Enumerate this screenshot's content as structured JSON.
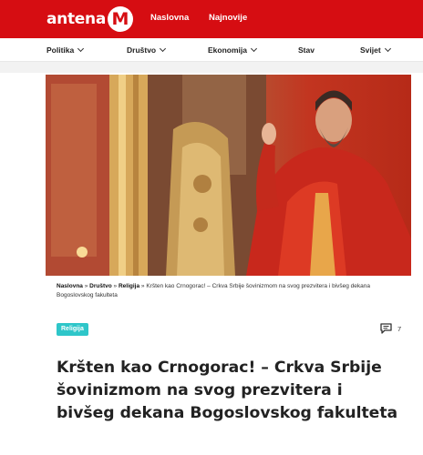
{
  "brand": {
    "name_text": "antena",
    "badge_letter": "M",
    "accent_color": "#d60d12"
  },
  "top_nav": {
    "naslovna": "Naslovna",
    "najnovije": "Najnovije"
  },
  "categories": [
    {
      "label": "Politika",
      "dropdown": true
    },
    {
      "label": "Društvo",
      "dropdown": true
    },
    {
      "label": "Ekonomija",
      "dropdown": true
    },
    {
      "label": "Stav",
      "dropdown": false
    },
    {
      "label": "Svijet",
      "dropdown": true
    }
  ],
  "breadcrumb": {
    "home": "Naslovna",
    "sep": "»",
    "section": "Društvo",
    "subsection": "Religija",
    "current": "Kršten kao Crnogorac! – Crkva Srbije šovinizmom na svog prezvitera i bivšeg dekana Bogoslovskog fakulteta"
  },
  "article": {
    "tag": "Religija",
    "tag_color": "#2ec6c9",
    "comment_count": "7",
    "title": "Kršten kao Crnogorac! – Crkva Srbije šovinizmom na svog prezvitera i bivšeg dekana Bogoslovskog fakulteta"
  },
  "icons": {
    "comments": "comment-bubble-icon",
    "dropdown": "chevron-down-icon"
  }
}
